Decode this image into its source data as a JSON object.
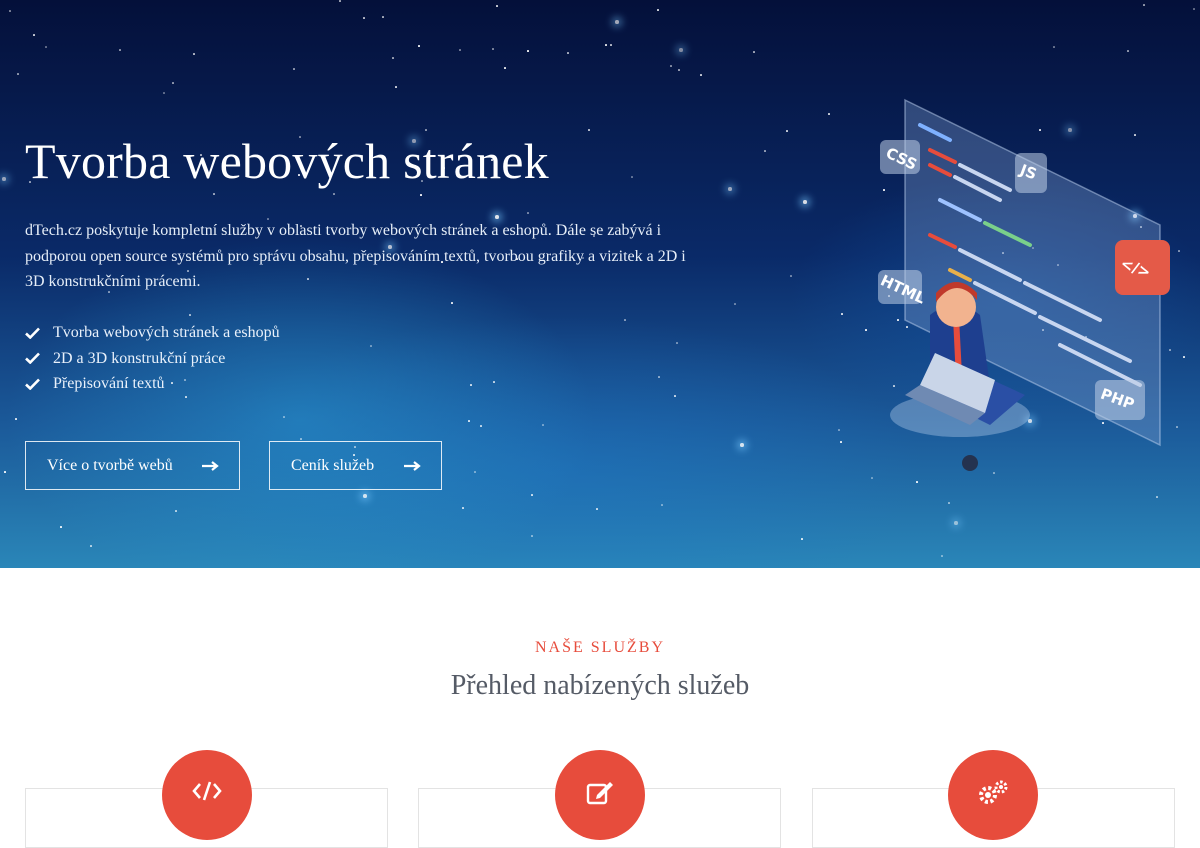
{
  "hero": {
    "title": "Tvorba webových stránek",
    "description": "dTech.cz poskytuje kompletní služby v oblasti tvorby webových stránek a eshopů. Dále se zabývá i podporou open source systémů pro správu obsahu, přepisováním textů, tvorbou grafiky a vizitek a 2D i 3D konstrukčními prácemi.",
    "features": [
      "Tvorba webových stránek a eshopů",
      "2D a 3D konstrukční práce",
      "Přepisování textů"
    ],
    "buttons": {
      "about_label": "Více o tvorbě webů",
      "pricing_label": "Ceník služeb"
    },
    "illustration": {
      "badges": [
        "CSS",
        "JS",
        "HTML",
        "PHP",
        "</>"
      ]
    }
  },
  "services": {
    "eyebrow": "NAŠE SLUŽBY",
    "title": "Přehled nabízených služeb",
    "cards": [
      {
        "icon": "code-icon"
      },
      {
        "icon": "edit-icon"
      },
      {
        "icon": "cogs-icon"
      }
    ]
  },
  "colors": {
    "accent": "#e74c3c",
    "hero_dark": "#04103a",
    "hero_light": "#2a86b8"
  }
}
